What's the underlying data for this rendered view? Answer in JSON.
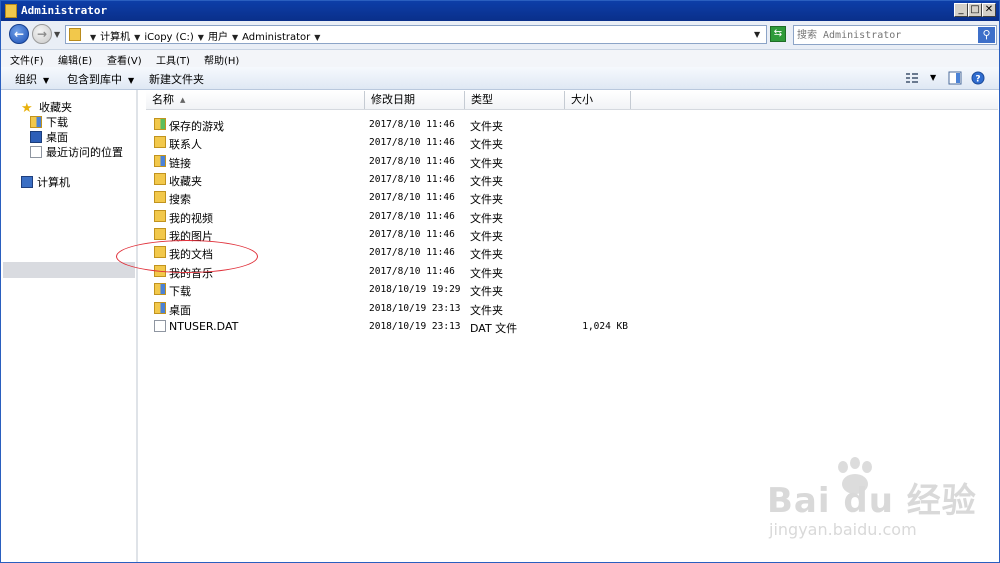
{
  "window": {
    "title": "Administrator",
    "min_label": "_",
    "max_label": "□",
    "close_label": "✕"
  },
  "address": {
    "crumbs": [
      "计算机",
      "iCopy (C:)",
      "用户",
      "Administrator"
    ],
    "search_placeholder": "搜索 Administrator"
  },
  "menu": [
    "文件(F)",
    "编辑(E)",
    "查看(V)",
    "工具(T)",
    "帮助(H)"
  ],
  "toolbar": {
    "organize": "组织",
    "include_library": "包含到库中",
    "new_folder": "新建文件夹"
  },
  "nav": {
    "favorites": "收藏夹",
    "downloads": "下载",
    "desktop": "桌面",
    "recent": "最近访问的位置",
    "computer": "计算机"
  },
  "columns": {
    "name": "名称",
    "modified": "修改日期",
    "type": "类型",
    "size": "大小"
  },
  "files": [
    {
      "name": "保存的游戏",
      "date": "2017/8/10 11:46",
      "type": "文件夹",
      "size": "",
      "icon": "folder-green"
    },
    {
      "name": "联系人",
      "date": "2017/8/10 11:46",
      "type": "文件夹",
      "size": "",
      "icon": "folder"
    },
    {
      "name": "链接",
      "date": "2017/8/10 11:46",
      "type": "文件夹",
      "size": "",
      "icon": "folder-blue"
    },
    {
      "name": "收藏夹",
      "date": "2017/8/10 11:46",
      "type": "文件夹",
      "size": "",
      "icon": "folder"
    },
    {
      "name": "搜索",
      "date": "2017/8/10 11:46",
      "type": "文件夹",
      "size": "",
      "icon": "folder"
    },
    {
      "name": "我的视频",
      "date": "2017/8/10 11:46",
      "type": "文件夹",
      "size": "",
      "icon": "folder"
    },
    {
      "name": "我的图片",
      "date": "2017/8/10 11:46",
      "type": "文件夹",
      "size": "",
      "icon": "folder"
    },
    {
      "name": "我的文档",
      "date": "2017/8/10 11:46",
      "type": "文件夹",
      "size": "",
      "icon": "folder"
    },
    {
      "name": "我的音乐",
      "date": "2017/8/10 11:46",
      "type": "文件夹",
      "size": "",
      "icon": "folder"
    },
    {
      "name": "下载",
      "date": "2018/10/19 19:29",
      "type": "文件夹",
      "size": "",
      "icon": "folder-blue"
    },
    {
      "name": "桌面",
      "date": "2018/10/19 23:13",
      "type": "文件夹",
      "size": "",
      "icon": "folder-blue"
    },
    {
      "name": "NTUSER.DAT",
      "date": "2018/10/19 23:13",
      "type": "DAT 文件",
      "size": "1,024 KB",
      "icon": "document"
    }
  ],
  "watermark": {
    "brand": "Bai du 经验",
    "url": "jingyan.baidu.com"
  },
  "colors": {
    "titlebar": "#0d3ea8",
    "highlight_circle": "#e0303a"
  }
}
